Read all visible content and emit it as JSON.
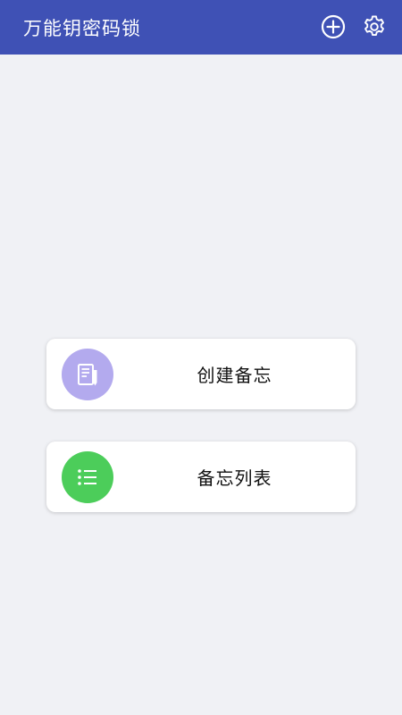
{
  "appbar": {
    "title": "万能钥密码锁",
    "color": "#3f51b5",
    "actions": [
      {
        "icon": "add-circle-icon"
      },
      {
        "icon": "gear-icon"
      }
    ]
  },
  "menu": {
    "items": [
      {
        "label": "创建备忘",
        "icon": "note-edit-icon",
        "color": "#b3aaee"
      },
      {
        "label": "备忘列表",
        "icon": "list-icon",
        "color": "#4ccd5a"
      }
    ]
  }
}
